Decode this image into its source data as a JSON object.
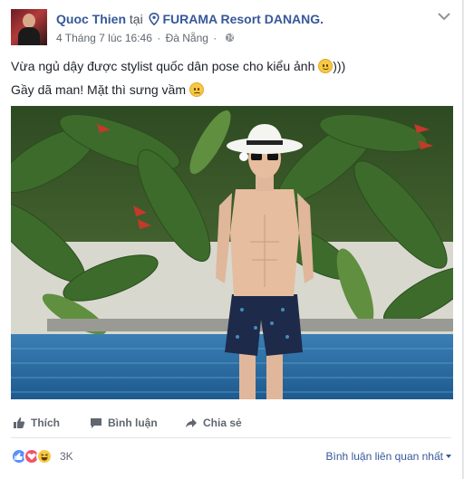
{
  "post": {
    "author": "Quoc Thien",
    "at_text": "tại",
    "location": "FURAMA Resort DANANG.",
    "timestamp": "4 Tháng 7 lúc 16:46",
    "separator": "·",
    "city": "Đà Nẵng",
    "privacy_icon": "globe-icon",
    "text_line1": "Vừa ngủ dậy được stylist quốc dân pose cho kiểu ảnh",
    "text_line1_suffix": ")))",
    "text_line2": "Gầy dã man! Mặt thì sưng vầm",
    "photo_icon": "pool-portrait-photo"
  },
  "actions": {
    "like": "Thích",
    "comment": "Bình luận",
    "share": "Chia sẻ"
  },
  "footer": {
    "reaction_count": "3K",
    "sort_label": "Bình luận liên quan nhất"
  },
  "colors": {
    "link": "#365899",
    "meta": "#616770",
    "like_reaction": "#5890ff",
    "love_reaction": "#f25268",
    "haha_reaction": "#f7c843"
  }
}
